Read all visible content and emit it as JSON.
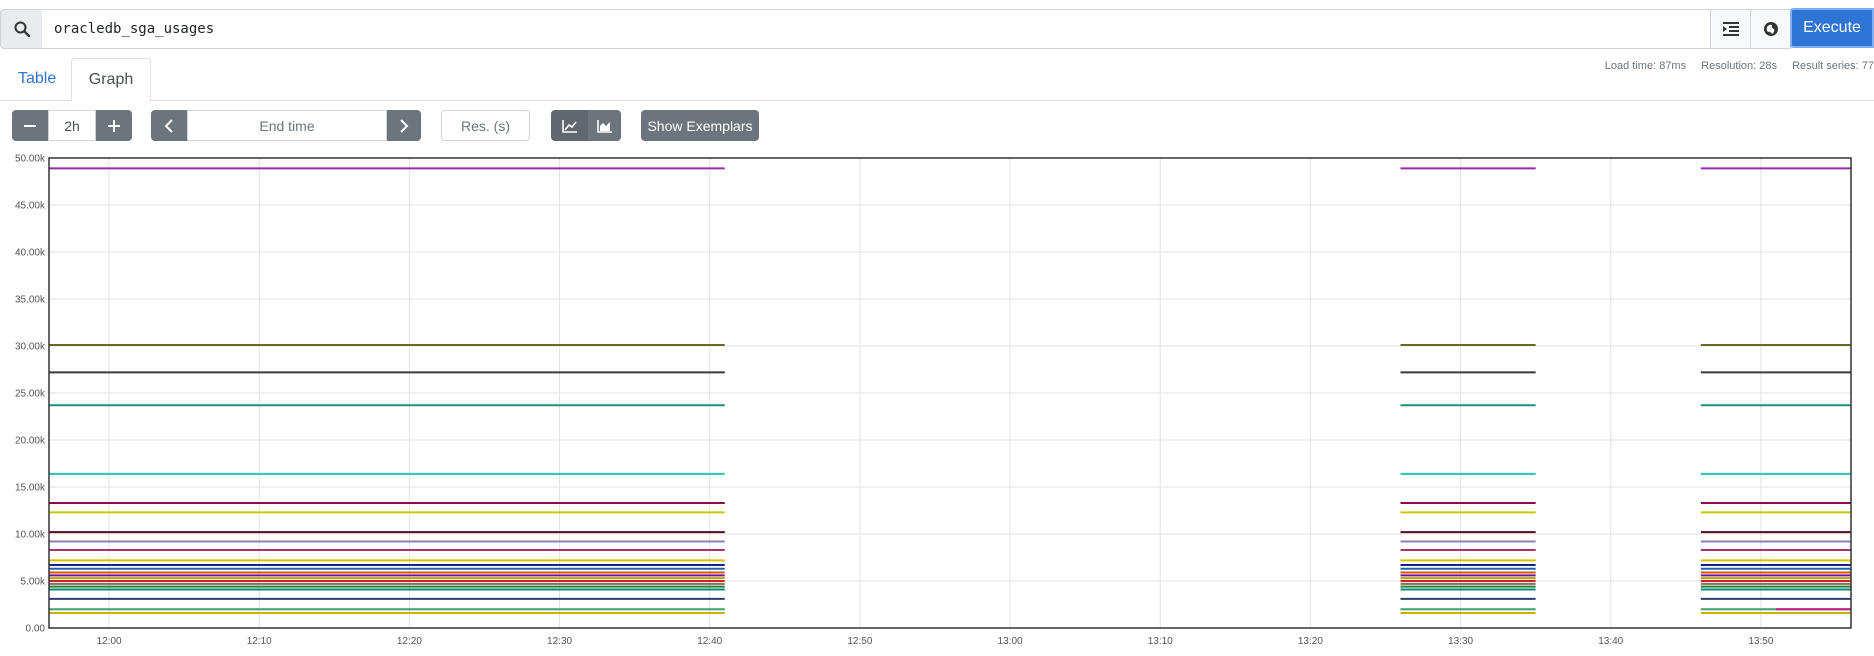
{
  "query": {
    "value": "oracledb_sga_usages"
  },
  "toolbar": {
    "execute_label": "Execute"
  },
  "tabs": [
    {
      "label": "Table"
    },
    {
      "label": "Graph"
    }
  ],
  "stats": {
    "load_time": "Load time: 87ms",
    "resolution": "Resolution: 28s",
    "result_series": "Result series: 77"
  },
  "controls": {
    "range_value": "2h",
    "end_time_placeholder": "End time",
    "resolution_placeholder": "Res. (s)",
    "show_exemplars_label": "Show Exemplars"
  },
  "icons": {
    "search": "search-icon",
    "format": "format-indent-icon",
    "metrics": "metrics-explorer-icon",
    "minus": "minus-icon",
    "plus": "plus-icon",
    "prev": "chevron-left-icon",
    "next": "chevron-right-icon",
    "line": "line-chart-icon",
    "stacked": "area-chart-icon"
  },
  "colors": {
    "accent": "#2f75d6",
    "button_gray": "#6c757d",
    "active_gray": "#5f6770"
  },
  "chart_data": {
    "type": "line",
    "y_ticks": [
      "0.00",
      "5.00k",
      "10.00k",
      "15.00k",
      "20.00k",
      "25.00k",
      "30.00k",
      "35.00k",
      "40.00k",
      "45.00k",
      "50.00k"
    ],
    "x_ticks": [
      "12:00",
      "12:10",
      "12:20",
      "12:30",
      "12:40",
      "12:50",
      "13:00",
      "13:10",
      "13:20",
      "13:30",
      "13:40",
      "13:50"
    ],
    "ylim": [
      0,
      50000
    ],
    "xlim": [
      "11:56",
      "13:56"
    ],
    "grid": true,
    "segments": [
      [
        "11:56",
        "12:41"
      ],
      [
        "13:26",
        "13:35"
      ],
      [
        "13:46",
        "13:56"
      ]
    ],
    "series": [
      {
        "color": "#9c27b0",
        "value": 48900
      },
      {
        "color": "#6b6b1f",
        "value": 30100
      },
      {
        "color": "#3a3a3a",
        "value": 27200
      },
      {
        "color": "#1f8f7f",
        "value": 23700
      },
      {
        "color": "#26c6b0",
        "value": 16400
      },
      {
        "color": "#8b0a4a",
        "value": 13300
      },
      {
        "color": "#c9c900",
        "value": 12300
      },
      {
        "color": "#5a0a20",
        "value": 10200
      },
      {
        "color": "#8a7fb8",
        "value": 9200
      },
      {
        "color": "#b03070",
        "value": 8300
      },
      {
        "color": "#d4c200",
        "value": 7200
      },
      {
        "color": "#1a237e",
        "value": 6700
      },
      {
        "color": "#1565c0",
        "value": 6300
      },
      {
        "color": "#e65100",
        "value": 5900
      },
      {
        "color": "#6a1b9a",
        "value": 5600
      },
      {
        "color": "#c0a000",
        "value": 5300
      },
      {
        "color": "#c62828",
        "value": 5000
      },
      {
        "color": "#8d6e63",
        "value": 4700
      },
      {
        "color": "#2e7d32",
        "value": 4400
      },
      {
        "color": "#00897b",
        "value": 4100
      },
      {
        "color": "#2f3f6f",
        "value": 3100
      },
      {
        "color": "#3fa06f",
        "value": 2000
      },
      {
        "color": "#c8b400",
        "value": 1600
      }
    ],
    "late_series": {
      "color": "#c2187c",
      "value": 2000,
      "from": "13:51",
      "to": "13:56"
    }
  }
}
